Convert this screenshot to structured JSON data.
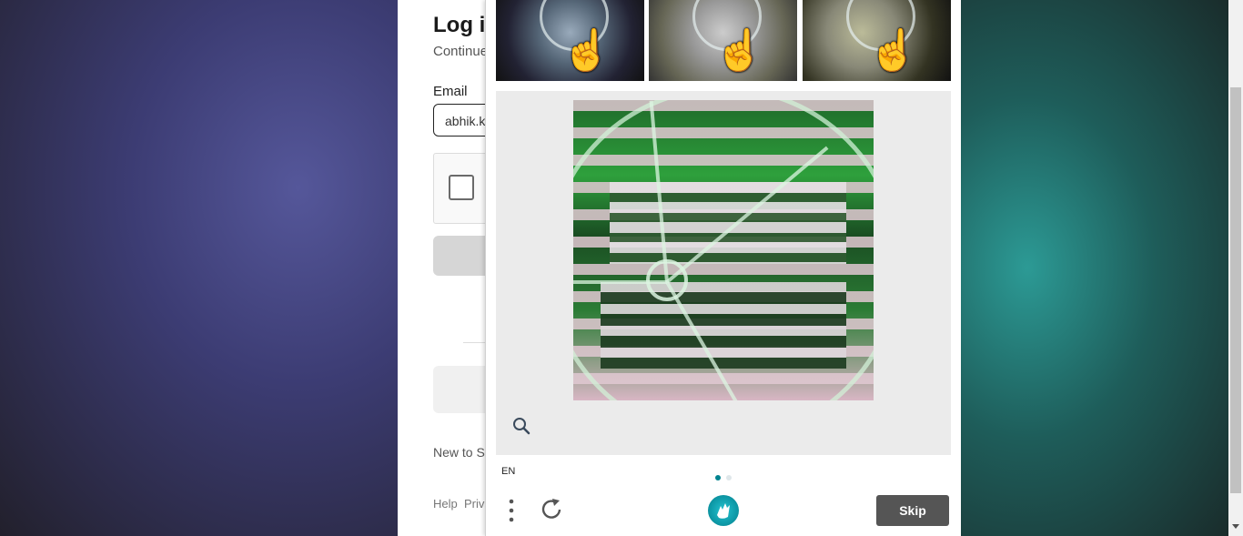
{
  "login": {
    "title": "Log i",
    "subtitle": "Continue",
    "email_label": "Email",
    "email_value": "abhik.k",
    "new_to_text": "New to S",
    "help_link": "Help",
    "privacy_link": "Priva"
  },
  "challenge": {
    "language": "EN",
    "skip_label": "Skip",
    "page_indicator": {
      "current": 1,
      "total": 2
    },
    "colors": {
      "accent": "#00838f",
      "skip_button": "#555555"
    },
    "icons": [
      "hand-pointer-icon",
      "zoom-icon",
      "menu-icon",
      "refresh-icon",
      "hcaptcha-logo-icon"
    ]
  }
}
